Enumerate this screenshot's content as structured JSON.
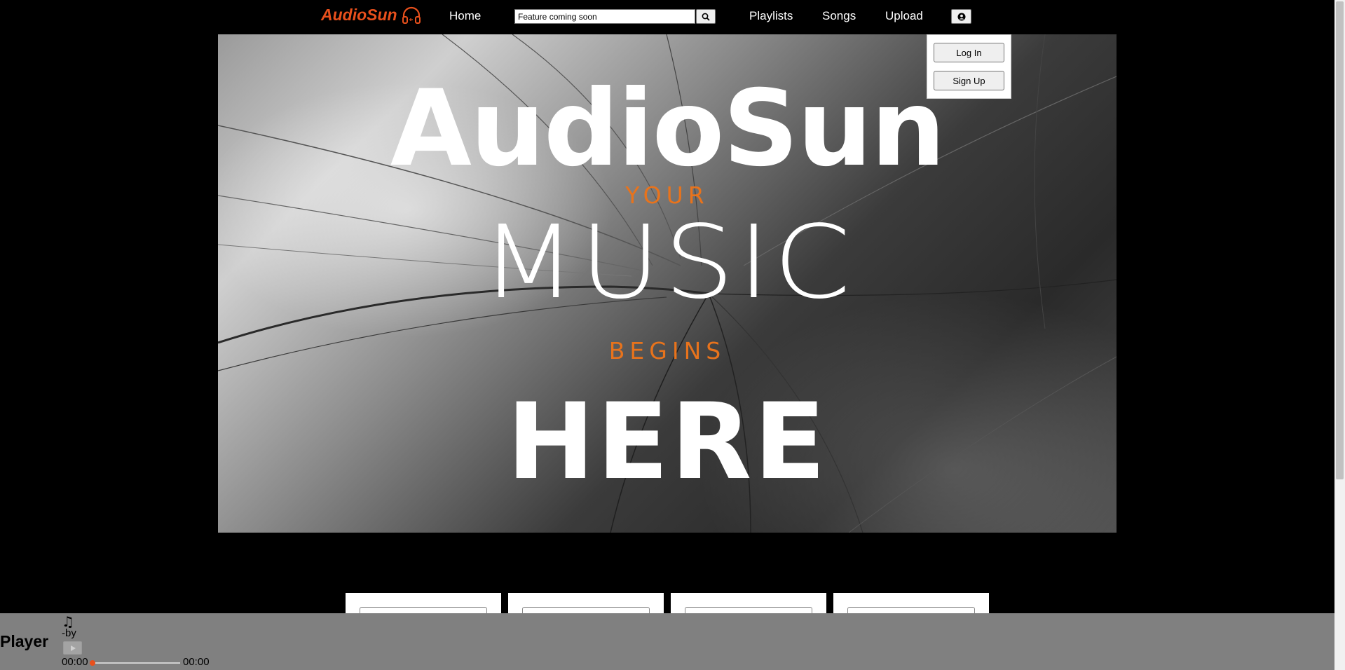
{
  "navbar": {
    "logo_text": "AudioSun",
    "links": {
      "home": "Home",
      "playlists": "Playlists",
      "songs": "Songs",
      "upload": "Upload"
    },
    "search": {
      "value": "Feature coming soon",
      "icon": "search-icon"
    },
    "account_icon": "user-circle-icon"
  },
  "account_menu": {
    "login_label": "Log In",
    "signup_label": "Sign Up"
  },
  "hero": {
    "title": "AudioSun",
    "line_your": "YOUR",
    "line_music": "MUSIC",
    "line_begins": "BEGINS",
    "line_here": "HERE"
  },
  "player": {
    "label": "Player",
    "note_icon": "♫",
    "artist_line": "-by",
    "current_time": "00:00",
    "total_time": "00:00",
    "progress_fraction": 0
  },
  "colors": {
    "brand": "#e8501c",
    "accent": "#e8731c",
    "player_bg": "#808080"
  }
}
